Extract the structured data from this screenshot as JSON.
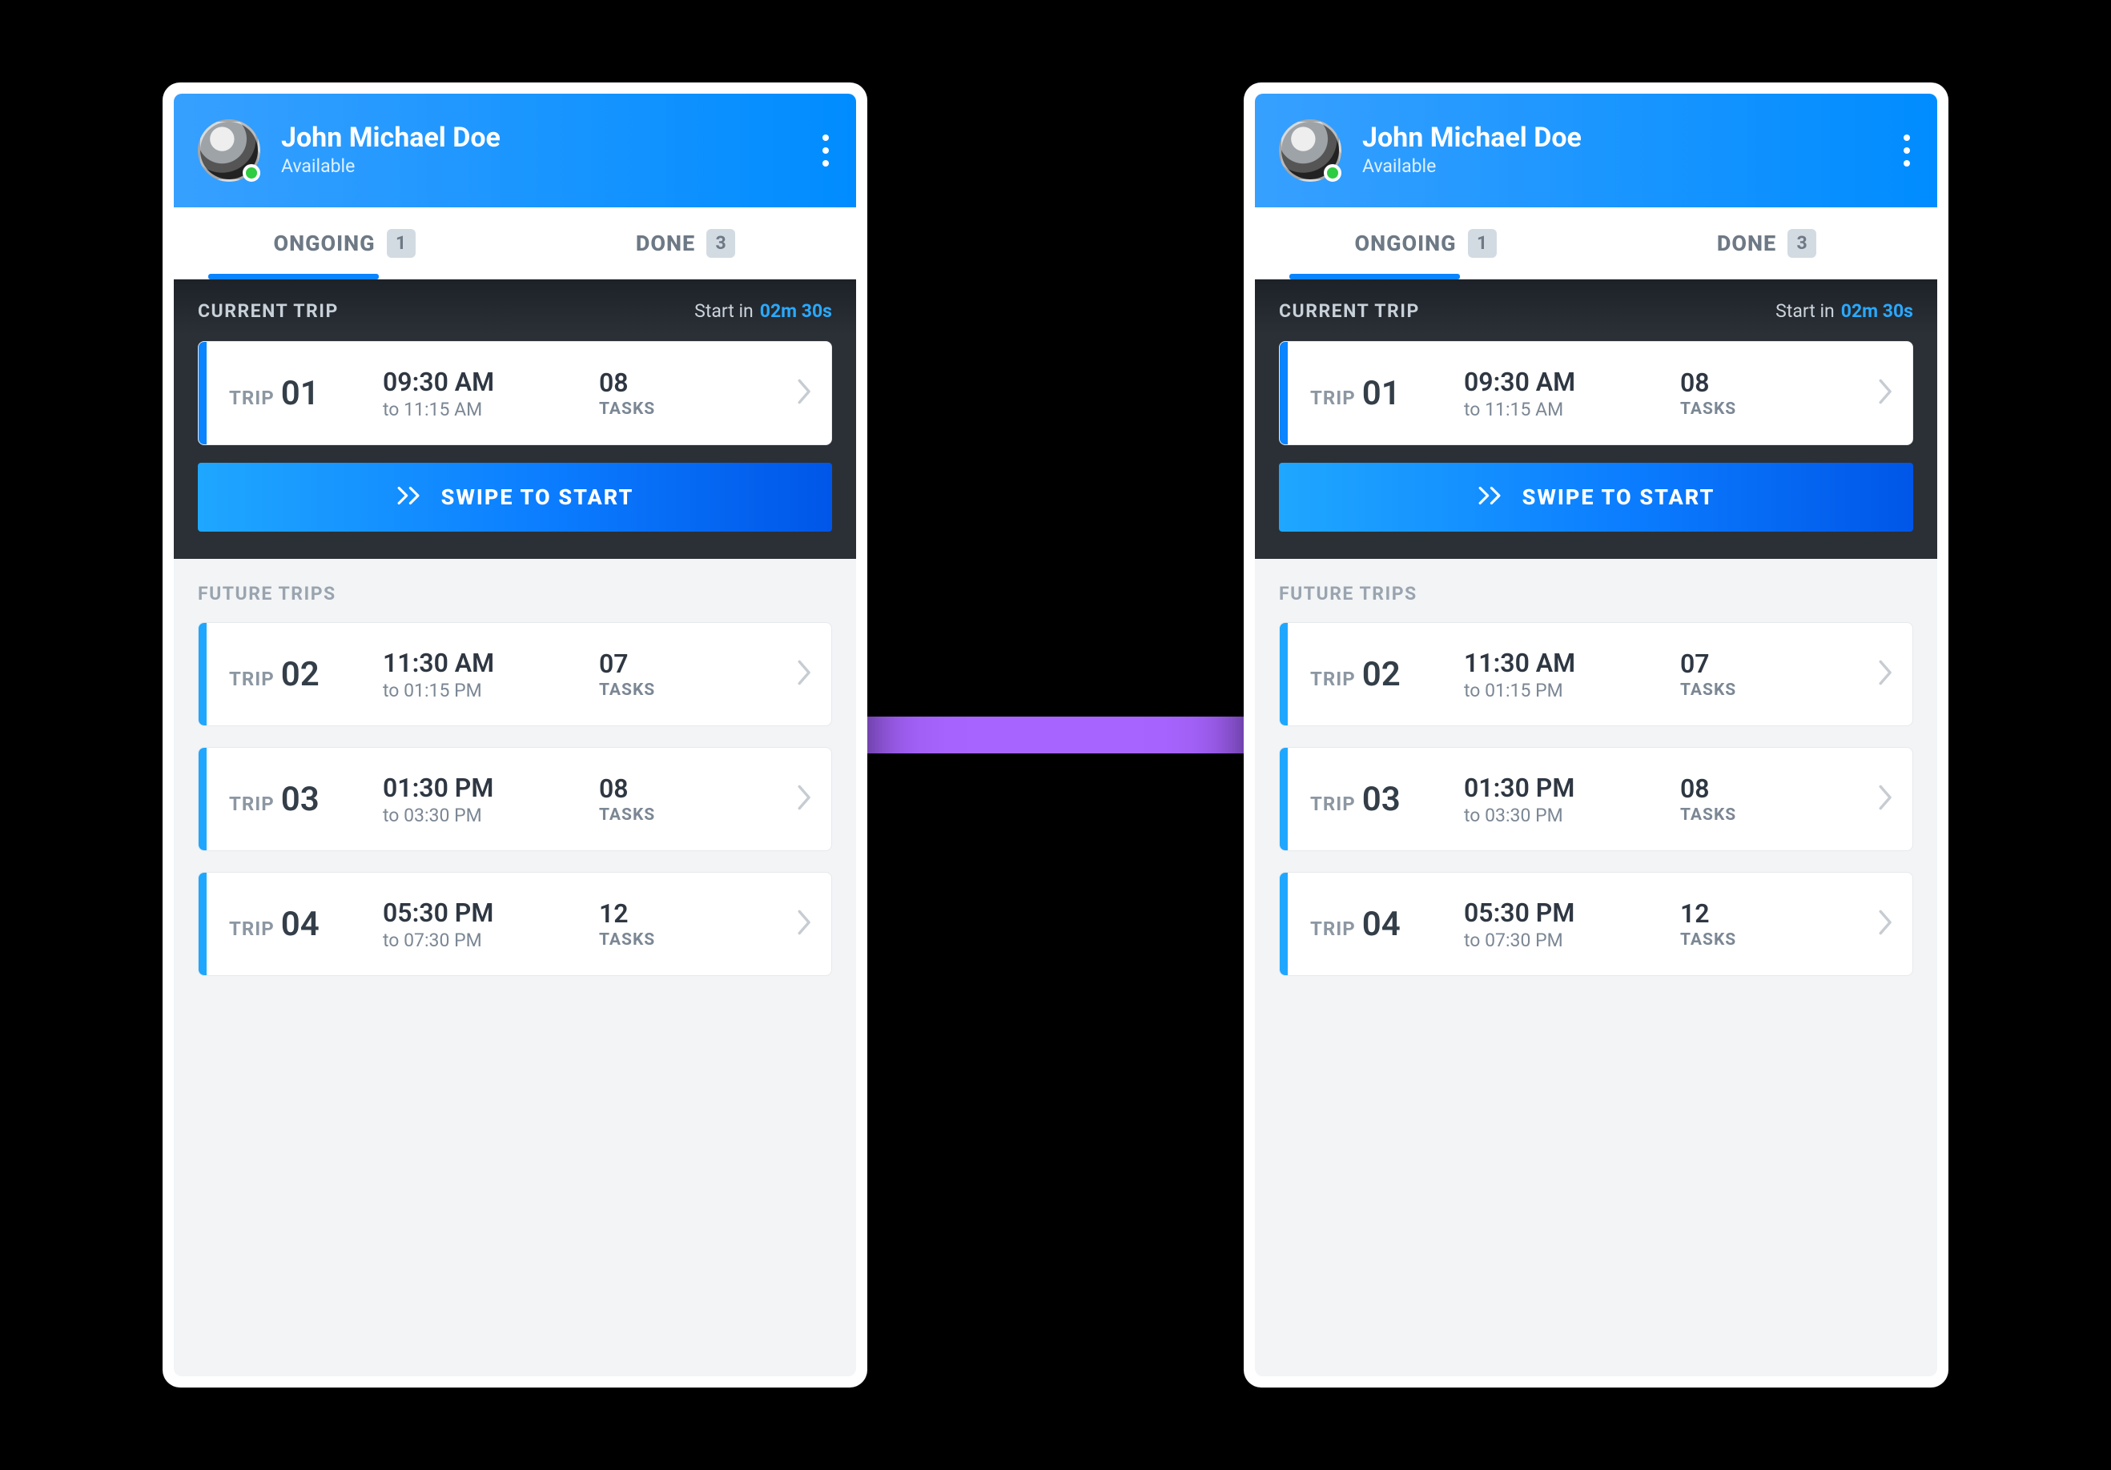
{
  "user": {
    "name": "John Michael Doe",
    "status": "Available"
  },
  "tabs": {
    "ongoing": {
      "label": "ONGOING",
      "count": "1"
    },
    "done": {
      "label": "DONE",
      "count": "3"
    }
  },
  "current": {
    "section_label": "CURRENT TRIP",
    "start_prefix": "Start in",
    "start_time": "02m 30s",
    "trip": {
      "label": "TRIP",
      "number": "01",
      "time_primary": "09:30 AM",
      "time_secondary": "to 11:15 AM",
      "task_count": "08",
      "task_label": "TASKS"
    },
    "swipe_label": "SWIPE TO START"
  },
  "future": {
    "section_label": "FUTURE TRIPS",
    "trips": [
      {
        "label": "TRIP",
        "number": "02",
        "time_primary": "11:30 AM",
        "time_secondary": "to 01:15 PM",
        "task_count": "07",
        "task_label": "TASKS"
      },
      {
        "label": "TRIP",
        "number": "03",
        "time_primary": "01:30 PM",
        "time_secondary": "to 03:30 PM",
        "task_count": "08",
        "task_label": "TASKS"
      },
      {
        "label": "TRIP",
        "number": "04",
        "time_primary": "05:30 PM",
        "time_secondary": "to 07:30 PM",
        "task_count": "12",
        "task_label": "TASKS"
      }
    ]
  },
  "icons": {
    "kebab": "more-vert-icon",
    "chevron": "chevron-right-icon",
    "double_chevron": "double-chevron-right-icon"
  }
}
